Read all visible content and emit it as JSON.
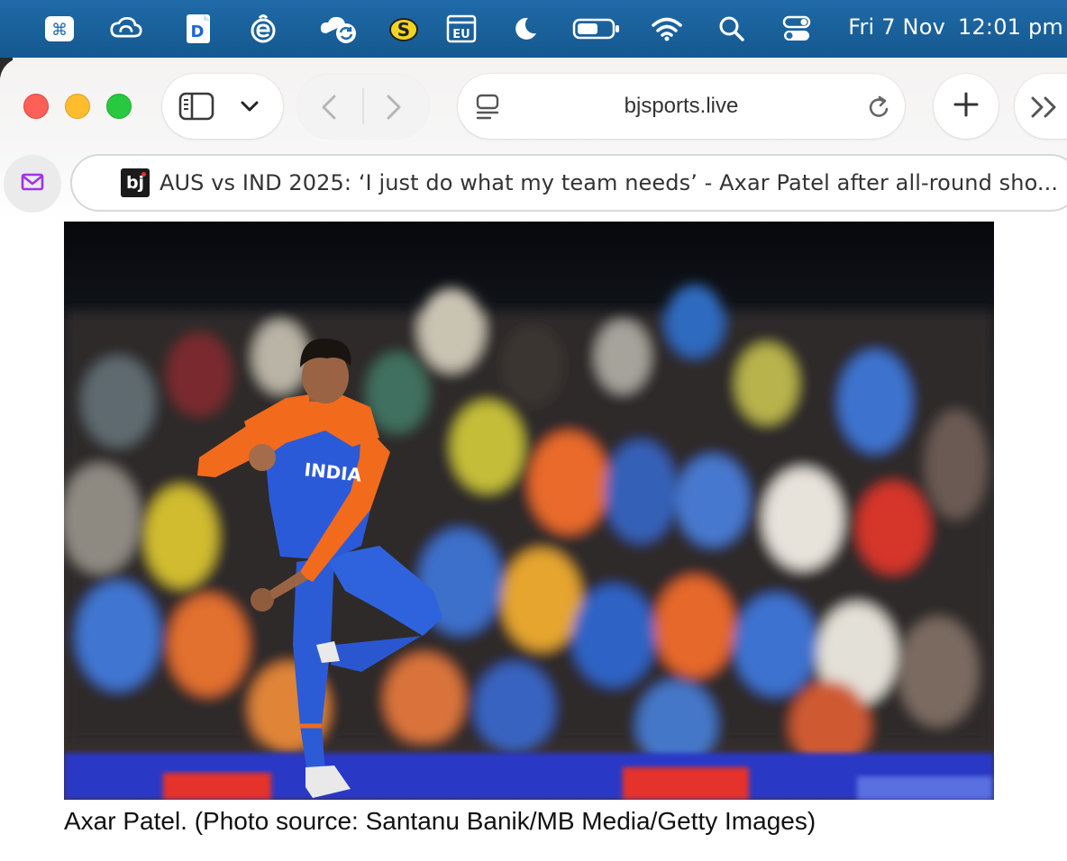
{
  "menubar": {
    "status_icons": [
      "command-key-icon",
      "creative-cloud-icon",
      "document-app-icon",
      "edge-browser-icon",
      "cloud-sync-icon",
      "s-app-icon",
      "eu-keyboard-icon",
      "moon-icon",
      "battery-icon",
      "wifi-icon",
      "search-icon",
      "control-center-icon"
    ],
    "input_source_label": "EU",
    "date": "Fri 7 Nov",
    "time": "12:01 pm"
  },
  "browser": {
    "address": "bjsports.live",
    "tab": {
      "favicon_text": "bj",
      "title": "AUS vs IND 2025: ‘I just do what my team needs’ - Axar Patel after all-round sho..."
    }
  },
  "article": {
    "caption": "Axar Patel. (Photo source: Santanu Banik/MB Media/Getty Images)",
    "photo_overlay_text": "INDIA"
  },
  "colors": {
    "menubar": "#15588f",
    "traffic_red": "#fe5f57",
    "traffic_yellow": "#febc2e",
    "traffic_green": "#28c840",
    "jersey_blue": "#2c5bd6",
    "jersey_orange": "#f26a1c"
  }
}
